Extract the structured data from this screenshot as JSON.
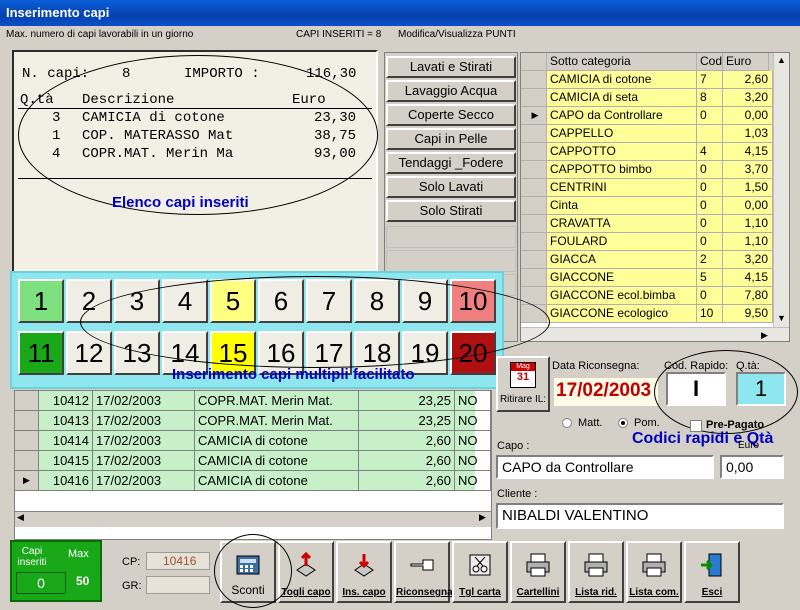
{
  "window": {
    "title": "Inserimento capi"
  },
  "infobar": {
    "max_label": "Max. numero di capi lavorabili in un giorno",
    "inserted": "CAPI INSERITI = 8",
    "modify_link": "Modifica/Visualizza PUNTI"
  },
  "receipt": {
    "n_label": "N. capi:",
    "n_value": "8",
    "importo_label": "IMPORTO :",
    "importo_value": "116,30",
    "h_qta": "Q.tà",
    "h_desc": "Descrizione",
    "h_euro": "Euro",
    "rows": [
      {
        "qta": "3",
        "desc": "CAMICIA di cotone",
        "euro": "23,30"
      },
      {
        "qta": "1",
        "desc": "COP. MATERASSO Mat",
        "euro": "38,75"
      },
      {
        "qta": "4",
        "desc": "COPR.MAT. Merin Ma",
        "euro": "93,00"
      }
    ]
  },
  "annotations": {
    "elenco": "Elenco capi inseriti",
    "multipli": "Inserimento capi multipli facilitato",
    "codici": "Codici rapidi e Qtà"
  },
  "categories": [
    "Lavati e Stirati",
    "Lavaggio Acqua",
    "Coperte Secco",
    "Capi in Pelle",
    "Tendaggi _Fodere",
    "Solo Lavati",
    "Solo Stirati"
  ],
  "grid": {
    "h_sub": "Sotto categoria",
    "h_cod": "Cod",
    "h_euro": "Euro",
    "rows": [
      {
        "name": "CAMICIA di cotone",
        "cod": "7",
        "euro": "2,60"
      },
      {
        "name": "CAMICIA di seta",
        "cod": "8",
        "euro": "3,20"
      },
      {
        "name": "CAPO da Controllare",
        "cod": "0",
        "euro": "0,00"
      },
      {
        "name": "CAPPELLO",
        "cod": "",
        "euro": "1,03"
      },
      {
        "name": "CAPPOTTO",
        "cod": "4",
        "euro": "4,15"
      },
      {
        "name": "CAPPOTTO bimbo",
        "cod": "0",
        "euro": "3,70"
      },
      {
        "name": "CENTRINI",
        "cod": "0",
        "euro": "1,50"
      },
      {
        "name": "Cinta",
        "cod": "0",
        "euro": "0,00"
      },
      {
        "name": "CRAVATTA",
        "cod": "0",
        "euro": "1,10"
      },
      {
        "name": "FOULARD",
        "cod": "0",
        "euro": "1,10"
      },
      {
        "name": "GIACCA",
        "cod": "2",
        "euro": "3,20"
      },
      {
        "name": "GIACCONE",
        "cod": "5",
        "euro": "4,15"
      },
      {
        "name": "GIACCONE ecol.bimba",
        "cod": "0",
        "euro": "7,80"
      },
      {
        "name": "GIACCONE ecologico",
        "cod": "10",
        "euro": "9,50"
      }
    ]
  },
  "numpad": [
    "1",
    "2",
    "3",
    "4",
    "5",
    "6",
    "7",
    "8",
    "9",
    "10",
    "11",
    "12",
    "13",
    "14",
    "15",
    "16",
    "17",
    "18",
    "19",
    "20"
  ],
  "colors": {
    "n1": "#7ee07e",
    "n5": "#ffff80",
    "n10": "#f08080",
    "n11": "#18a818",
    "n15": "#ffff00",
    "n20": "#b01010",
    "grid_yellow": "#ffff99",
    "table_green": "#c8f0c8"
  },
  "table": {
    "rows": [
      {
        "id": "10412",
        "date": "17/02/2003",
        "desc": "COPR.MAT. Merin Mat.",
        "euro": "23,25",
        "flag": "NO"
      },
      {
        "id": "10413",
        "date": "17/02/2003",
        "desc": "COPR.MAT. Merin Mat.",
        "euro": "23,25",
        "flag": "NO"
      },
      {
        "id": "10414",
        "date": "17/02/2003",
        "desc": "CAMICIA di cotone",
        "euro": "2,60",
        "flag": "NO"
      },
      {
        "id": "10415",
        "date": "17/02/2003",
        "desc": "CAMICIA di cotone",
        "euro": "2,60",
        "flag": "NO"
      },
      {
        "id": "10416",
        "date": "17/02/2003",
        "desc": "CAMICIA di cotone",
        "euro": "2,60",
        "flag": "NO"
      }
    ]
  },
  "right": {
    "ritirare": "Ritirare IL:",
    "data_label": "Data Riconsegna:",
    "data_value": "17/02/2003",
    "cod_label": "Cod. Rapido:",
    "cod_value": "I",
    "qta_label": "Q.tà:",
    "qta_value": "1",
    "matt": "Matt.",
    "pom": "Pom.",
    "prepagato": "Pre-Pagato",
    "capo_label": "Capo :",
    "capo_value": "CAPO da Controllare",
    "euro_label": "Euro",
    "euro_value": "0,00",
    "cliente_label": "Cliente :",
    "cliente_value": "NIBALDI VALENTINO",
    "cal_month": "Mag",
    "cal_day": "31"
  },
  "status": {
    "capi_label": "Capi inseriti",
    "capi_value": "0",
    "max_label": "Max",
    "max_value": "50",
    "cp_label": "CP:",
    "cp_value": "10416",
    "gr_label": "GR:"
  },
  "toolbar": [
    "Sconti",
    "Togli capo",
    "Ins. capo",
    "Riconsegna",
    "Tgl carta",
    "Cartellini",
    "Lista rid.",
    "Lista com.",
    "Esci"
  ]
}
